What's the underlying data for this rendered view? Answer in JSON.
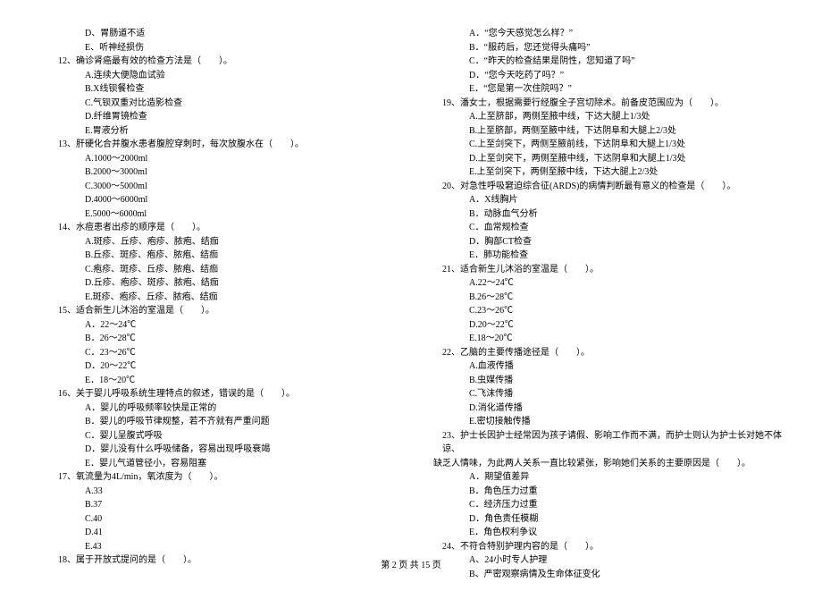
{
  "left": {
    "pre11": [
      "D、胃肠道不适",
      "E、听神经损伤"
    ],
    "q12": {
      "stem": "12、确诊肾癌最有效的检查方法是（　　）。",
      "opts": [
        "A.连续大便隐血试验",
        "B.X线钡餐检查",
        "C.气钡双重对比造影检查",
        "D.纤维胃镜检查",
        "E.胃液分析"
      ]
    },
    "q13": {
      "stem": "13、肝硬化合并腹水患者腹腔穿刺时，每次放腹水在（　　）。",
      "opts": [
        "A.1000～2000ml",
        "B.2000～3000ml",
        "C.3000～5000ml",
        "D.4000～6000ml",
        "E.5000～6000ml"
      ]
    },
    "q14": {
      "stem": "14、水痘患者出疹的顺序是（　　）。",
      "opts": [
        "A.斑疹、丘疹、疱疹、脓疱、结痂",
        "B.丘疹、斑疹、疱疹、脓疱、结痂",
        "C.疱疹、斑疹、丘疹、脓疱、结痂",
        "D.丘疹、疱疹、斑疹、脓疱、结痂",
        "E.斑疹、疱疹、丘疹、脓疱、结痂"
      ]
    },
    "q15": {
      "stem": "15、适合新生儿沐浴的室温是（　　）。",
      "opts": [
        "A．22～24℃",
        "B．26～28℃",
        "C．23～26℃",
        "D．20～22℃",
        "E．18～20℃"
      ]
    },
    "q16": {
      "stem": "16、关于婴儿呼吸系统生理特点的叙述，错误的是（　　）。",
      "opts": [
        "A．婴儿的呼吸频率较快是正常的",
        "B．婴儿的呼吸节律规整，若不齐就有严重问题",
        "C．婴儿呈腹式呼吸",
        "D．婴儿没有什么呼吸储备，容易出现呼吸衰竭",
        "E．婴儿气道管径小，容易阻塞"
      ]
    },
    "q17": {
      "stem": "17、氧流量为4L/min，氧浓度为（　　）。",
      "opts": [
        "A.33",
        "B.37",
        "C.40",
        "D.41",
        "E.43"
      ]
    },
    "q18": {
      "stem": "18、属于开放式提问的是（　　）。"
    }
  },
  "right": {
    "q18opts": [
      "A．“您今天感觉怎么样？”",
      "B．“服药后，您还觉得头痛吗”",
      "C．“昨天的检查结果是阴性，您知道了吗”",
      "D．“您今天吃药了吗？”",
      "E．“您是第一次住院吗？”"
    ],
    "q19": {
      "stem": "19、潘女士，根据需要行经腹全子宫切除术。前备皮范围应为（　　）。",
      "opts": [
        "A.上至脐部，两侧至腋中线，下达大腿上1/3处",
        "B.上至脐部，两侧至腋中线，下达阴阜和大腿上2/3处",
        "C.上至剑突下，两侧至腋前线，下达阴阜和大腿上1/3处",
        "D.上至剑突下，两侧至腋中线，下达阴阜和大腿上1/3处",
        "E.上至剑突下，两侧至腋中线，下达大腿上2/3处"
      ]
    },
    "q20": {
      "stem": "20、对急性呼吸窘迫综合征(ARDS)的病情判断最有意义的检查是（　　）。",
      "opts": [
        "A．X线胸片",
        "B．动脉血气分析",
        "C．血常规检查",
        "D．胸部CT检查",
        "E．肺功能检查"
      ]
    },
    "q21": {
      "stem": "21、适合新生儿沐浴的室温是（　　）。",
      "opts": [
        "A.22～24℃",
        "B.26～28℃",
        "C.23～26℃",
        "D.20～22℃",
        "E.18～20℃"
      ]
    },
    "q22": {
      "stem": "22、乙脑的主要传播途径是（　　）。",
      "opts": [
        "A.血液传播",
        "B.虫媒传播",
        "C.飞沫传播",
        "D.消化道传播",
        "E.密切接触传播"
      ]
    },
    "q23": {
      "stem1": "23、护士长因护士经常因为孩子请假、影响工作而不满，而护士则认为护士长对她不体谅、",
      "stem2": "缺乏人情味，为此两人关系一直比较紧张，影响她们关系的主要原因是（　　）。",
      "opts": [
        "A．期望值差异",
        "B．角色压力过重",
        "C．经济压力过重",
        "D．角色责任模糊",
        "E．角色权利争议"
      ]
    },
    "q24": {
      "stem": "24、不符合特别护理内容的是（　　）。",
      "opts": [
        "A、24小时专人护理",
        "B、严密观察病情及生命体征变化"
      ]
    }
  },
  "footer": "第 2 页 共 15 页"
}
